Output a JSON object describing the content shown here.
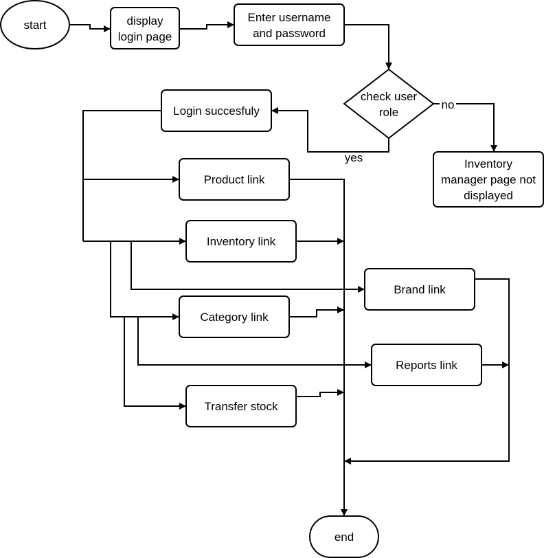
{
  "diagram": {
    "type": "flowchart",
    "nodes": {
      "start": {
        "shape": "ellipse",
        "lines": [
          "start"
        ]
      },
      "display_login": {
        "shape": "rounded-rect",
        "lines": [
          "display",
          "login page"
        ]
      },
      "enter_credentials": {
        "shape": "rounded-rect",
        "lines": [
          "Enter username",
          "and password"
        ]
      },
      "check_role": {
        "shape": "diamond",
        "lines": [
          "check user",
          "role"
        ]
      },
      "login_success": {
        "shape": "rounded-rect",
        "lines": [
          "Login succesfuly"
        ]
      },
      "not_displayed": {
        "shape": "rounded-rect",
        "lines": [
          "Inventory",
          "manager page not",
          "displayed"
        ]
      },
      "product_link": {
        "shape": "rounded-rect",
        "lines": [
          "Product link"
        ]
      },
      "inventory_link": {
        "shape": "rounded-rect",
        "lines": [
          "Inventory link"
        ]
      },
      "brand_link": {
        "shape": "rounded-rect",
        "lines": [
          "Brand link"
        ]
      },
      "category_link": {
        "shape": "rounded-rect",
        "lines": [
          "Category link"
        ]
      },
      "reports_link": {
        "shape": "rounded-rect",
        "lines": [
          "Reports link"
        ]
      },
      "transfer_stock": {
        "shape": "rounded-rect",
        "lines": [
          "Transfer stock"
        ]
      },
      "end": {
        "shape": "terminator",
        "lines": [
          "end"
        ]
      }
    },
    "edges": [
      {
        "from": "start",
        "to": "display_login",
        "label": ""
      },
      {
        "from": "display_login",
        "to": "enter_credentials",
        "label": ""
      },
      {
        "from": "enter_credentials",
        "to": "check_role",
        "label": ""
      },
      {
        "from": "check_role",
        "to": "not_displayed",
        "label": "no"
      },
      {
        "from": "check_role",
        "to": "login_success",
        "label": "yes"
      },
      {
        "from": "login_success",
        "to": "product_link",
        "label": ""
      },
      {
        "from": "login_success",
        "to": "inventory_link",
        "label": ""
      },
      {
        "from": "login_success",
        "to": "brand_link",
        "label": ""
      },
      {
        "from": "login_success",
        "to": "category_link",
        "label": ""
      },
      {
        "from": "login_success",
        "to": "reports_link",
        "label": ""
      },
      {
        "from": "login_success",
        "to": "transfer_stock",
        "label": ""
      },
      {
        "from": "product_link",
        "to": "end",
        "label": ""
      },
      {
        "from": "inventory_link",
        "to": "end",
        "label": ""
      },
      {
        "from": "category_link",
        "to": "end",
        "label": ""
      },
      {
        "from": "transfer_stock",
        "to": "end",
        "label": ""
      },
      {
        "from": "brand_link",
        "to": "end",
        "label": ""
      },
      {
        "from": "reports_link",
        "to": "end",
        "label": ""
      }
    ],
    "edge_labels": {
      "no": "no",
      "yes": "yes"
    }
  }
}
